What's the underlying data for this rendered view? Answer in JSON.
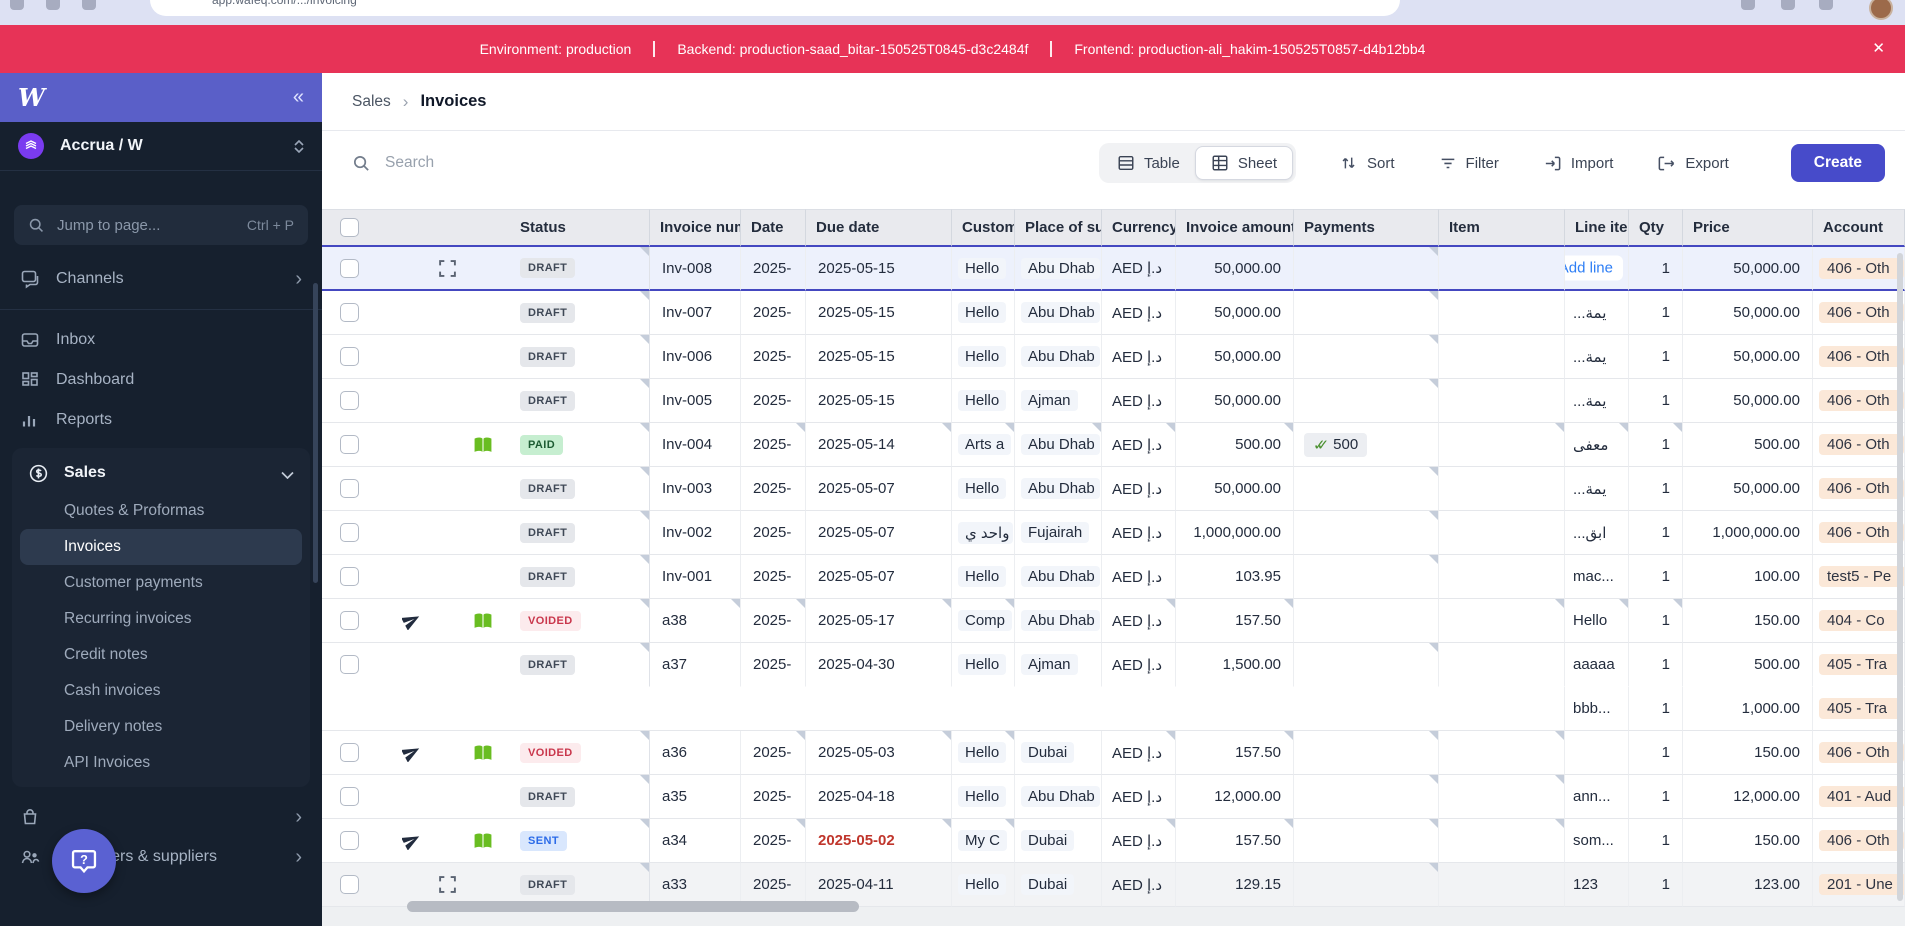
{
  "browser": {
    "url_text": "app.wafeq.com/.../invoicing"
  },
  "banner": {
    "items": [
      "Environment: production",
      "Backend: production-saad_bitar-150525T0845-d3c2484f",
      "Frontend: production-ali_hakim-150525T0857-d4b12bb4"
    ],
    "close_icon": "✕"
  },
  "sidebar": {
    "logo": "W",
    "collapse_icon": "«",
    "workspace": {
      "name": "Accrua / W"
    },
    "jump": {
      "placeholder": "Jump to page...",
      "shortcut": "Ctrl + P"
    },
    "nav_top": [
      {
        "label": "Channels",
        "icon": "chat",
        "chevron": true
      }
    ],
    "nav_main": [
      {
        "label": "Inbox",
        "icon": "inbox"
      },
      {
        "label": "Dashboard",
        "icon": "dashboard"
      },
      {
        "label": "Reports",
        "icon": "reports"
      }
    ],
    "sales": {
      "label": "Sales",
      "icon": "sales",
      "expanded": true,
      "children": [
        "Quotes & Proformas",
        "Invoices",
        "Customer payments",
        "Recurring invoices",
        "Credit notes",
        "Cash invoices",
        "Delivery notes",
        "API Invoices"
      ],
      "active": "Invoices"
    },
    "nav_bottom": [
      {
        "label": "",
        "icon": "bag",
        "chevron": true
      },
      {
        "label": "Customers & suppliers",
        "icon": "people",
        "chevron": true
      }
    ],
    "help_label": "?"
  },
  "main": {
    "breadcrumb": {
      "parent": "Sales",
      "separator": "›",
      "current": "Invoices"
    },
    "toolbar": {
      "search_placeholder": "Search",
      "view_table": "Table",
      "view_sheet": "Sheet",
      "active_view": "Sheet",
      "sort": "Sort",
      "filter": "Filter",
      "import": "Import",
      "export": "Export",
      "create": "Create"
    },
    "table": {
      "columns": [
        {
          "key": "check",
          "label": ""
        },
        {
          "key": "icons",
          "label": ""
        },
        {
          "key": "status",
          "label": "Status"
        },
        {
          "key": "number",
          "label": "Invoice number"
        },
        {
          "key": "date",
          "label": "Date"
        },
        {
          "key": "due",
          "label": "Due date"
        },
        {
          "key": "customer",
          "label": "Customer"
        },
        {
          "key": "place",
          "label": "Place of supply"
        },
        {
          "key": "currency",
          "label": "Currency"
        },
        {
          "key": "amount",
          "label": "Invoice amount"
        },
        {
          "key": "payments",
          "label": "Payments"
        },
        {
          "key": "item",
          "label": "Item"
        },
        {
          "key": "lineitem",
          "label": "Line item"
        },
        {
          "key": "qty",
          "label": "Qty"
        },
        {
          "key": "price",
          "label": "Price"
        },
        {
          "key": "account",
          "label": "Account"
        }
      ],
      "rows": [
        {
          "number": "Inv-008",
          "status": "DRAFT",
          "status_type": "draft",
          "icons": [
            "expand"
          ],
          "date": "2025-",
          "due_date": "2025-05-15",
          "due_overdue": false,
          "customer": "Hello",
          "place": "Abu Dhab",
          "currency": "AED د.إ",
          "amount": "50,000.00",
          "payment": null,
          "selected": true,
          "add_line_label": "Add line",
          "lines": [
            {
              "item": "",
              "qty": "1",
              "price": "50,000.00",
              "account": "406 - Oth"
            }
          ],
          "corners": [
            "status",
            "payments"
          ]
        },
        {
          "number": "Inv-007",
          "status": "DRAFT",
          "status_type": "draft",
          "icons": [],
          "date": "2025-",
          "due_date": "2025-05-15",
          "due_overdue": false,
          "customer": "Hello",
          "place": "Abu Dhab",
          "currency": "AED د.إ",
          "amount": "50,000.00",
          "payment": null,
          "lines": [
            {
              "item": "...يمة",
              "qty": "1",
              "price": "50,000.00",
              "account": "406 - Oth"
            }
          ],
          "corners": [
            "status",
            "payments"
          ]
        },
        {
          "number": "Inv-006",
          "status": "DRAFT",
          "status_type": "draft",
          "icons": [],
          "date": "2025-",
          "due_date": "2025-05-15",
          "due_overdue": false,
          "customer": "Hello",
          "place": "Abu Dhab",
          "currency": "AED د.إ",
          "amount": "50,000.00",
          "payment": null,
          "lines": [
            {
              "item": "...يمة",
              "qty": "1",
              "price": "50,000.00",
              "account": "406 - Oth"
            }
          ],
          "corners": [
            "status",
            "payments"
          ]
        },
        {
          "number": "Inv-005",
          "status": "DRAFT",
          "status_type": "draft",
          "icons": [],
          "date": "2025-",
          "due_date": "2025-05-15",
          "due_overdue": false,
          "customer": "Hello",
          "place": "Ajman",
          "currency": "AED د.إ",
          "amount": "50,000.00",
          "payment": null,
          "lines": [
            {
              "item": "...يمة",
              "qty": "1",
              "price": "50,000.00",
              "account": "406 - Oth"
            }
          ],
          "corners": [
            "status",
            "payments"
          ]
        },
        {
          "number": "Inv-004",
          "status": "PAID",
          "status_type": "paid",
          "icons": [
            "book"
          ],
          "date": "2025-",
          "due_date": "2025-05-14",
          "due_overdue": false,
          "customer": "Arts a",
          "place": "Abu Dhab",
          "currency": "AED د.إ",
          "amount": "500.00",
          "payment": "500",
          "lines": [
            {
              "item": "معفى",
              "qty": "1",
              "price": "500.00",
              "account": "406 - Oth"
            }
          ],
          "corners": [
            "status",
            "date",
            "due",
            "customer",
            "place",
            "currency",
            "amount",
            "item",
            "lineitem",
            "qty"
          ]
        },
        {
          "number": "Inv-003",
          "status": "DRAFT",
          "status_type": "draft",
          "icons": [],
          "date": "2025-",
          "due_date": "2025-05-07",
          "due_overdue": false,
          "customer": "Hello",
          "place": "Abu Dhab",
          "currency": "AED د.إ",
          "amount": "50,000.00",
          "payment": null,
          "lines": [
            {
              "item": "...يمة",
              "qty": "1",
              "price": "50,000.00",
              "account": "406 - Oth"
            }
          ],
          "corners": [
            "status",
            "payments"
          ]
        },
        {
          "number": "Inv-002",
          "status": "DRAFT",
          "status_type": "draft",
          "icons": [],
          "date": "2025-",
          "due_date": "2025-05-07",
          "due_overdue": false,
          "customer": "واحد ي",
          "place": "Fujairah",
          "currency": "AED د.إ",
          "amount": "1,000,000.00",
          "payment": null,
          "lines": [
            {
              "item": "...ابق",
              "qty": "1",
              "price": "1,000,000.00",
              "account": "406 - Oth"
            }
          ],
          "corners": [
            "status",
            "payments"
          ]
        },
        {
          "number": "Inv-001",
          "status": "DRAFT",
          "status_type": "draft",
          "icons": [],
          "date": "2025-",
          "due_date": "2025-05-07",
          "due_overdue": false,
          "customer": "Hello",
          "place": "Abu Dhab",
          "currency": "AED د.إ",
          "amount": "103.95",
          "payment": null,
          "lines": [
            {
              "item": "mac...",
              "qty": "1",
              "price": "100.00",
              "account": "test5 - Pe"
            }
          ],
          "corners": [
            "status",
            "payments"
          ]
        },
        {
          "number": "a38",
          "status": "VOIDED",
          "status_type": "voided",
          "icons": [
            "send",
            "book"
          ],
          "date": "2025-",
          "due_date": "2025-05-17",
          "due_overdue": false,
          "customer": "Comp",
          "place": "Abu Dhab",
          "currency": "AED د.إ",
          "amount": "157.50",
          "payment": null,
          "lines": [
            {
              "item": "Hello",
              "qty": "1",
              "price": "150.00",
              "account": "404 - Co"
            }
          ],
          "corners": [
            "status",
            "number",
            "date",
            "due",
            "customer",
            "currency",
            "amount",
            "item",
            "lineitem",
            "qty"
          ]
        },
        {
          "number": "a37",
          "status": "DRAFT",
          "status_type": "draft",
          "icons": [],
          "date": "2025-",
          "due_date": "2025-04-30",
          "due_overdue": false,
          "customer": "Hello",
          "place": "Ajman",
          "currency": "AED د.إ",
          "amount": "1,500.00",
          "payment": null,
          "lines": [
            {
              "item": "aaaaa",
              "qty": "1",
              "price": "500.00",
              "account": "405 - Tra"
            },
            {
              "item": "bbb...",
              "qty": "1",
              "price": "1,000.00",
              "account": "405 - Tra"
            }
          ],
          "corners": [
            "status",
            "payments"
          ]
        },
        {
          "number": "a36",
          "status": "VOIDED",
          "status_type": "voided",
          "icons": [
            "send",
            "book"
          ],
          "date": "2025-",
          "due_date": "2025-05-03",
          "due_overdue": false,
          "customer": "Hello",
          "place": "Dubai",
          "currency": "AED د.إ",
          "amount": "157.50",
          "payment": null,
          "lines": [
            {
              "item": "",
              "qty": "1",
              "price": "150.00",
              "account": "406 - Oth"
            }
          ],
          "corners": [
            "status",
            "date",
            "due",
            "customer",
            "currency",
            "amount",
            "payments",
            "item"
          ]
        },
        {
          "number": "a35",
          "status": "DRAFT",
          "status_type": "draft",
          "icons": [],
          "date": "2025-",
          "due_date": "2025-04-18",
          "due_overdue": false,
          "customer": "Hello",
          "place": "Abu Dhab",
          "currency": "AED د.إ",
          "amount": "12,000.00",
          "payment": null,
          "lines": [
            {
              "item": "ann...",
              "qty": "1",
              "price": "12,000.00",
              "account": "401 - Aud"
            }
          ],
          "corners": [
            "status",
            "payments",
            "item"
          ]
        },
        {
          "number": "a34",
          "status": "SENT",
          "status_type": "sent",
          "icons": [
            "send",
            "book"
          ],
          "date": "2025-",
          "due_date": "2025-05-02",
          "due_overdue": true,
          "customer": "My C",
          "place": "Dubai",
          "currency": "AED د.إ",
          "amount": "157.50",
          "payment": null,
          "lines": [
            {
              "item": "som...",
              "qty": "1",
              "price": "150.00",
              "account": "406 - Oth"
            }
          ],
          "corners": [
            "status",
            "date",
            "due",
            "customer",
            "currency",
            "amount",
            "payments",
            "item"
          ]
        },
        {
          "number": "a33",
          "status": "DRAFT",
          "status_type": "draft",
          "icons": [
            "expand"
          ],
          "date": "2025-",
          "due_date": "2025-04-11",
          "due_overdue": false,
          "customer": "Hello",
          "place": "Dubai",
          "currency": "AED د.إ",
          "amount": "129.15",
          "payment": null,
          "gray": true,
          "lines": [
            {
              "item": "123",
              "qty": "1",
              "price": "123.00",
              "account": "201 - Une"
            }
          ],
          "corners": [
            "status",
            "payments"
          ]
        }
      ]
    }
  },
  "colors": {
    "banner": "#e73357",
    "sidebar_bg": "#16202e",
    "sidebar_header": "#5a5fc8",
    "accent_selected": "#4448c0",
    "create_button": "#474bca",
    "paid_badge": "#c6eed0",
    "voided_badge": "#fcebed",
    "sent_badge": "#d9e7fd",
    "draft_badge": "#e5e7eb",
    "account_chip": "#fbe8d8",
    "book_icon": "#69bd21",
    "overdue_text": "#c0362c",
    "add_line_link": "#2e7ef5"
  }
}
